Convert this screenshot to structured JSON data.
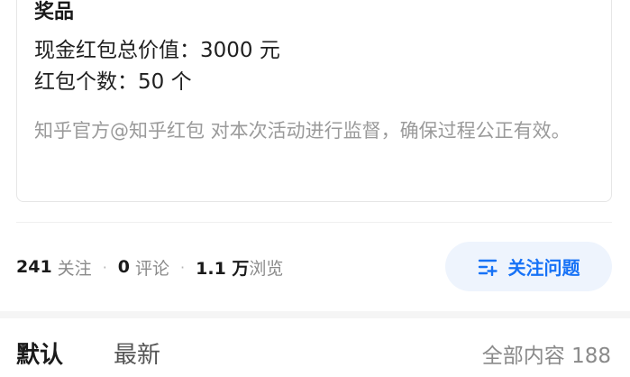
{
  "prize": {
    "title": "奖品",
    "total_value": "现金红包总价值：3000 元",
    "count": "红包个数：50 个",
    "note": "知乎官方@知乎红包 对本次活动进行监督，确保过程公正有效。"
  },
  "stats": {
    "followers_count": "241",
    "followers_label": "关注",
    "comments_count": "0",
    "comments_label": "评论",
    "views_count": "1.1 万",
    "views_label": "浏览",
    "separator": "·"
  },
  "follow_button": {
    "label": "关注问题",
    "icon": "follow-list-plus-icon"
  },
  "tabs": {
    "default_label": "默认",
    "latest_label": "最新"
  },
  "all_content": "全部内容 188",
  "colors": {
    "accent": "#1772f6",
    "button_bg": "#eef4fd",
    "muted_text": "#8a8a8a"
  }
}
